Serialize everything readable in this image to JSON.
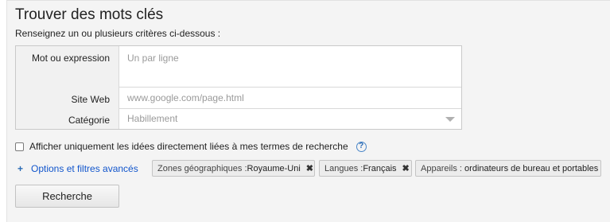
{
  "header": {
    "title": "Trouver des mots clés",
    "subtitle": "Renseignez un ou plusieurs critères ci-dessous :"
  },
  "form": {
    "keyword_label": "Mot ou expression",
    "keyword_placeholder": "Un par ligne",
    "site_label": "Site Web",
    "site_placeholder": "www.google.com/page.html",
    "category_label": "Catégorie",
    "category_value": "Habillement"
  },
  "options": {
    "checkbox_label": "Afficher uniquement les idées directement liées à mes termes de recherche",
    "checkbox_checked": false,
    "help_glyph": "?",
    "plus_glyph": "+",
    "filters_link": "Options et filtres avancés"
  },
  "filters": [
    {
      "key": "Zones géographiques :",
      "value": "Royaume-Uni",
      "removable": true
    },
    {
      "key": "Langues :",
      "value": "Français",
      "removable": true
    },
    {
      "key": "Appareils :",
      "value": "ordinateurs de bureau et portables",
      "removable": false
    }
  ],
  "remove_glyph": "✖",
  "search_button": "Recherche"
}
